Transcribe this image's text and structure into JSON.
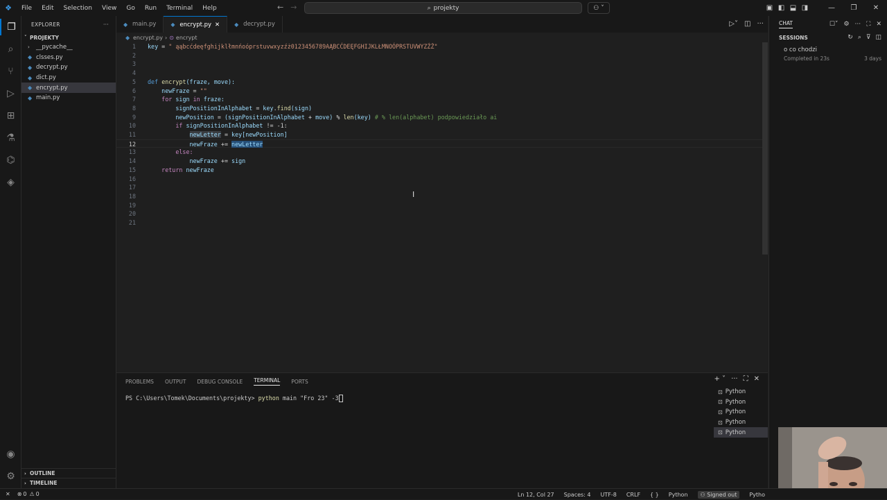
{
  "menu": [
    "File",
    "Edit",
    "Selection",
    "View",
    "Go",
    "Run",
    "Terminal",
    "Help"
  ],
  "search": {
    "text": "projekty"
  },
  "explorer": {
    "title": "EXPLORER",
    "root": "PROJEKTY",
    "items": [
      {
        "name": "__pycache__",
        "type": "folder"
      },
      {
        "name": "clsses.py",
        "type": "file"
      },
      {
        "name": "decrypt.py",
        "type": "file"
      },
      {
        "name": "dict.py",
        "type": "file"
      },
      {
        "name": "encrypt.py",
        "type": "file"
      },
      {
        "name": "main.py",
        "type": "file"
      }
    ],
    "outline": "OUTLINE",
    "timeline": "TIMELINE"
  },
  "tabs": [
    {
      "label": "main.py"
    },
    {
      "label": "encrypt.py"
    },
    {
      "label": "decrypt.py"
    }
  ],
  "breadcrumbs": {
    "file": "encrypt.py",
    "symbol": "encrypt"
  },
  "code": {
    "l1_key": "key",
    "l1_str": "\" ąąbcćdeęfghijklłmnńoóprstuvwxyzźż0123456789AĄBCĆDEĘFGHIJKLŁMNOÓPRSTUVWYZŹŻ\"",
    "l6_def": "def",
    "l6_name": "encrypt",
    "l6_args": "(fraze, move):",
    "l7": "newFraze",
    "l7_str": "\"\"",
    "l8_for": "for",
    "l8_sign": "sign",
    "l8_in": "in",
    "l8_fraze": "fraze:",
    "l9_var": "signPositionInAlphabet",
    "l9_rhs_key": "key",
    "l9_find": "find",
    "l9_sign": "(sign)",
    "l10_var": "newPosition",
    "l10_a": "(signPositionInAlphabet",
    "l10_move": "move)",
    "l10_len": "len",
    "l10_key": "(key)",
    "l10_cmt": "# % len(alphabet) podpowiedziało ai",
    "l11_if": "if",
    "l11_var": "signPositionInAlphabet",
    "l11_op": "!= -1:",
    "l12_var": "newLetter",
    "l12_rhs": "key[newPosition]",
    "l13_var": "newFraze",
    "l13_op": "+=",
    "l13_rhs": "newLetter",
    "l14_else": "else:",
    "l15_var": "newFraze",
    "l15_op": "+=",
    "l15_rhs": "sign",
    "l16_ret": "return",
    "l16_var": "newFraze",
    "line_numbers": [
      "1",
      "2",
      "3",
      "4",
      "5",
      "6",
      "7",
      "8",
      "9",
      "10",
      "11",
      "12",
      "13",
      "14",
      "15",
      "16",
      "17",
      "18",
      "19",
      "20",
      "21"
    ]
  },
  "panel": {
    "tabs": [
      "PROBLEMS",
      "OUTPUT",
      "DEBUG CONSOLE",
      "TERMINAL",
      "PORTS"
    ],
    "active_tab": "TERMINAL",
    "prompt": "PS C:\\Users\\Tomek\\Documents\\projekty>",
    "command": "python",
    "args": "main \"Fro 23\" -3",
    "terminals": [
      "Python",
      "Python",
      "Python",
      "Python",
      "Python"
    ]
  },
  "chat": {
    "title": "CHAT",
    "sessions_label": "SESSIONS",
    "session": {
      "title": "o co chodzi",
      "status": "Completed in 23s",
      "age": "3 days"
    }
  },
  "statusbar": {
    "errors": "0",
    "warnings": "0",
    "position": "Ln 12, Col 27",
    "spaces": "Spaces: 4",
    "encoding": "UTF-8",
    "eol": "CRLF",
    "braces": "{ }",
    "language": "Python",
    "signed": "Signed out",
    "lang2": "Pytho"
  }
}
